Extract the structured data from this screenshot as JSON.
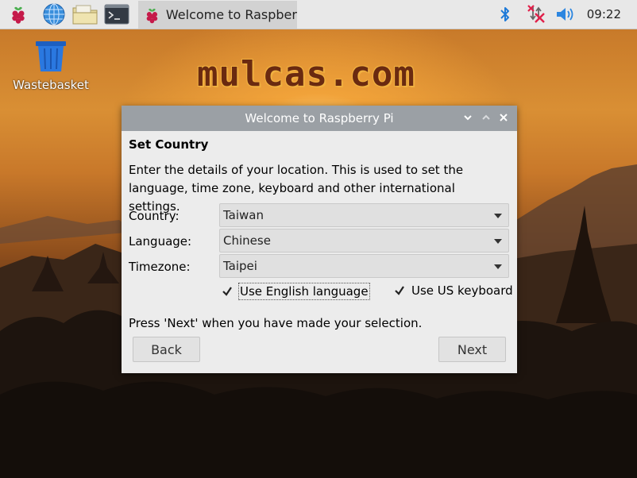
{
  "taskbar": {
    "task_title": "Welcome to Raspberr…",
    "clock": "09:22",
    "icons": [
      "raspberry-menu-icon",
      "web-browser-icon",
      "file-manager-icon",
      "terminal-icon",
      "bluetooth-icon",
      "network-disconnected-icon",
      "volume-icon"
    ]
  },
  "desktop": {
    "icon_label": "Wastebasket",
    "watermark": "mulcas.com"
  },
  "dialog": {
    "title": "Welcome to Raspberry Pi",
    "heading": "Set Country",
    "description": "Enter the details of your location. This is used to set the language, time zone, keyboard and other international settings.",
    "country": {
      "label": "Country:",
      "value": "Taiwan"
    },
    "language": {
      "label": "Language:",
      "value": "Chinese"
    },
    "timezone": {
      "label": "Timezone:",
      "value": "Taipei"
    },
    "use_english": {
      "label": "Use English language",
      "checked": true
    },
    "use_us_keyboard": {
      "label": "Use US keyboard",
      "checked": true
    },
    "hint": "Press 'Next' when you have made your selection.",
    "back_label": "Back",
    "next_label": "Next"
  },
  "colors": {
    "titlebar": "#9ba0a5",
    "dialog_bg": "#ececec",
    "taskbar_bg": "#e8e8e8"
  }
}
